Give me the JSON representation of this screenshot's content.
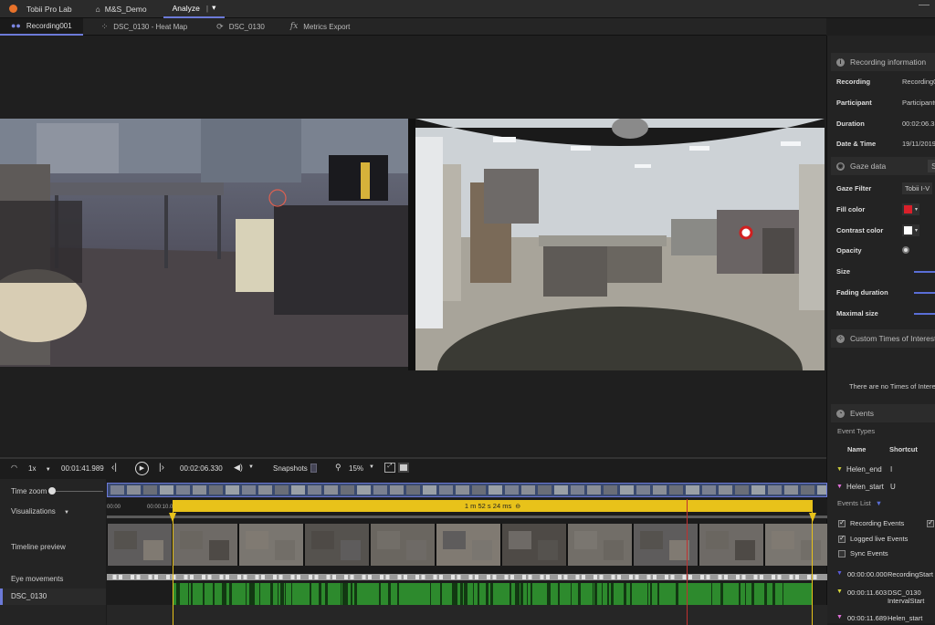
{
  "topbar": {
    "app_name": "Tobii Pro Lab",
    "project": "M&S_Demo",
    "mode": "Analyze",
    "dropdown": "▾"
  },
  "tabs": [
    {
      "label": "Recording001",
      "icon": "recording-icon"
    },
    {
      "label": "DSC_0130 - Heat Map",
      "icon": "heatmap-icon"
    },
    {
      "label": "DSC_0130",
      "icon": "snapshot-icon"
    },
    {
      "label": "Metrics Export",
      "icon": "fx-icon"
    }
  ],
  "recording_info": {
    "header": "Recording information",
    "rows": [
      {
        "label": "Recording",
        "value": "Recording0"
      },
      {
        "label": "Participant",
        "value": "Participant0"
      },
      {
        "label": "Duration",
        "value": "00:02:06.33"
      },
      {
        "label": "Date & Time",
        "value": "19/11/2019"
      }
    ]
  },
  "gaze_data": {
    "header": "Gaze data",
    "tab_letter": "S",
    "rows": [
      {
        "label": "Gaze Filter",
        "value": "Tobii I-V"
      },
      {
        "label": "Fill color",
        "value": ""
      },
      {
        "label": "Contrast color",
        "value": ""
      },
      {
        "label": "Opacity",
        "value": ""
      },
      {
        "label": "Size",
        "value": ""
      },
      {
        "label": "Fading duration",
        "value": ""
      },
      {
        "label": "Maximal size",
        "value": ""
      }
    ],
    "fill_color": "#d9202a",
    "contrast_color": "#ffffff"
  },
  "times_of_interest": {
    "header": "Custom Times of Interest",
    "empty_text": "There are no Times of Interest"
  },
  "events": {
    "header": "Events",
    "types_label": "Event Types",
    "col_name": "Name",
    "col_shortcut": "Shortcut",
    "types": [
      {
        "name": "Helen_end",
        "shortcut": "I",
        "color": "#c8c83a"
      },
      {
        "name": "Helen_start",
        "shortcut": "U",
        "color": "#e070d8"
      }
    ],
    "list_label": "Events List",
    "filters": [
      {
        "label": "Recording Events",
        "checked": true
      },
      {
        "label": "Logged live Events",
        "checked": true
      },
      {
        "label": "Sync Events",
        "checked": false
      }
    ],
    "list": [
      {
        "time": "00:00:00.000",
        "name": "RecordingStart",
        "color": "#5a5ad8"
      },
      {
        "time": "00:00:11.603",
        "name": "DSC_0130",
        "name2": "IntervalStart",
        "color": "#d8d83a"
      },
      {
        "time": "00:00:11.689",
        "name": "Helen_start",
        "color": "#e070d8"
      }
    ]
  },
  "controls": {
    "speed": "1x",
    "current_time": "00:01:41.989",
    "total_time": "00:02:06.330",
    "snapshots_label": "Snapshots",
    "zoom": "15%"
  },
  "timeline": {
    "labels": [
      "Time zoom",
      "Visualizations",
      "Timeline preview",
      "Eye movements",
      "DSC_0130"
    ],
    "interval_label": "1 m 52 s 24 ms",
    "ruler_ticks": [
      "00:00",
      "00:00:10.0"
    ]
  }
}
